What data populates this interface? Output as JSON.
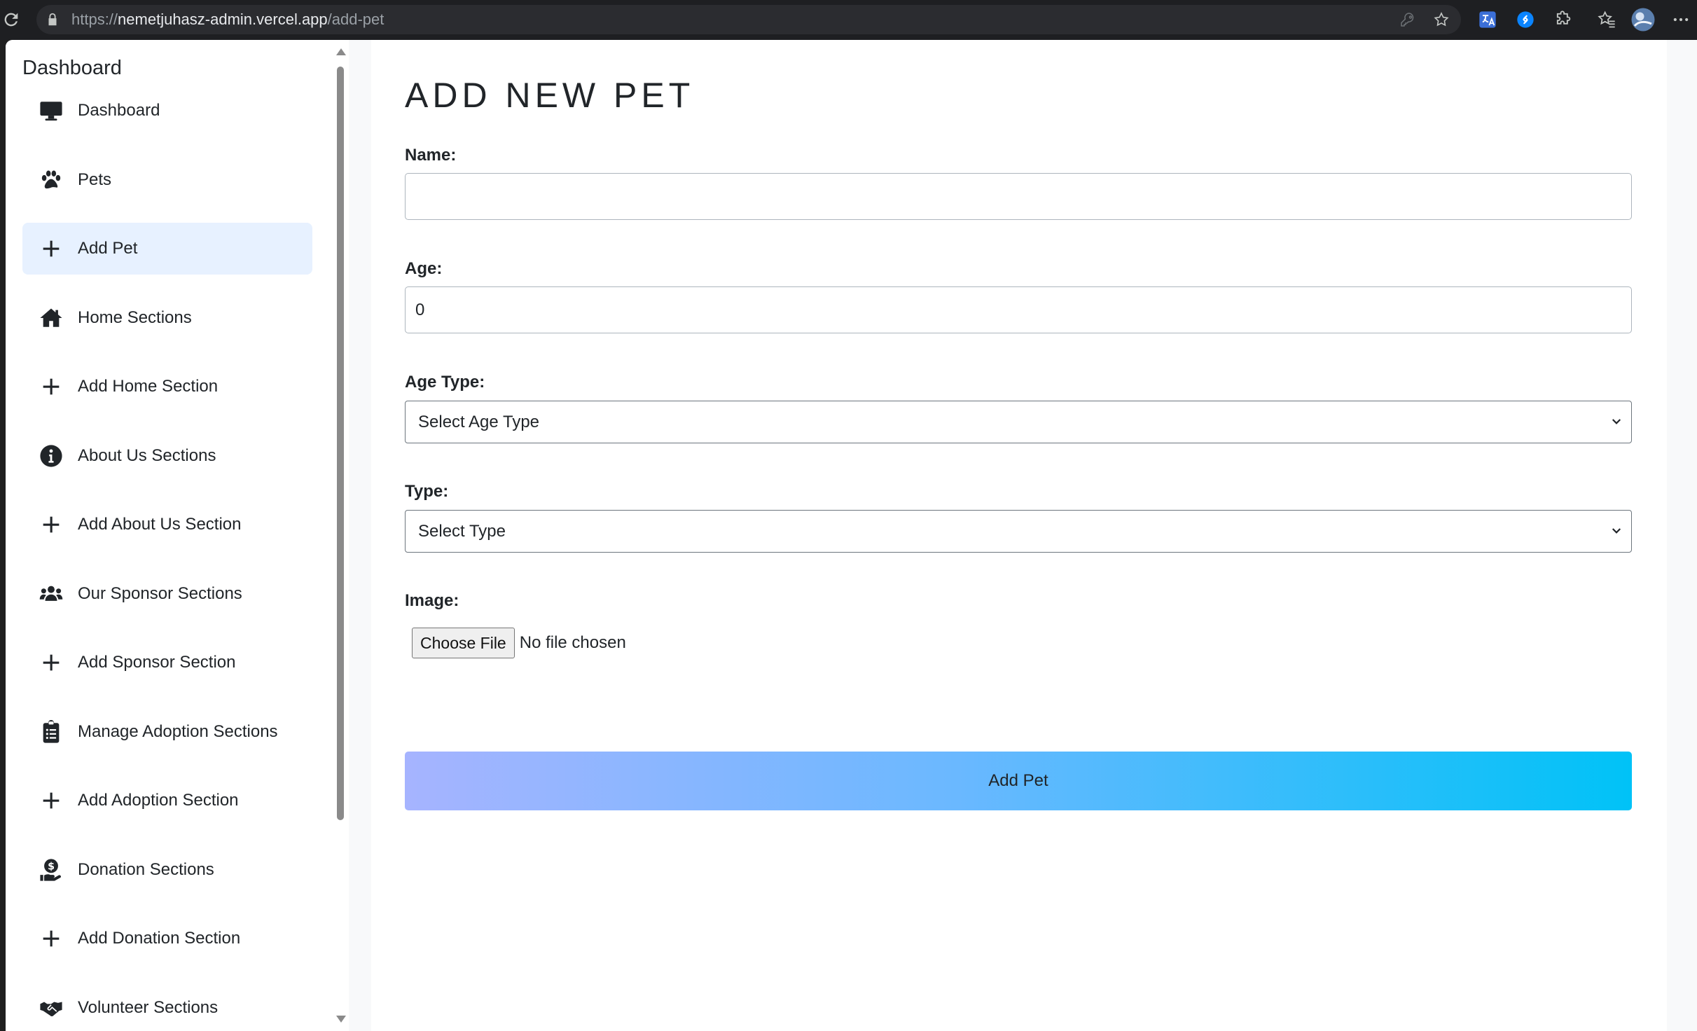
{
  "browser": {
    "url_prefix": "https://",
    "url_host": "nemetjuhasz-admin.vercel.app",
    "url_path": "/add-pet"
  },
  "sidebar": {
    "title": "Dashboard",
    "items": [
      {
        "label": "Dashboard",
        "icon": "desktop-icon"
      },
      {
        "label": "Pets",
        "icon": "paw-icon"
      },
      {
        "label": "Add Pet",
        "icon": "plus-icon",
        "active": true
      },
      {
        "label": "Home Sections",
        "icon": "home-icon"
      },
      {
        "label": "Add Home Section",
        "icon": "plus-icon"
      },
      {
        "label": "About Us Sections",
        "icon": "info-circle-icon"
      },
      {
        "label": "Add About Us Section",
        "icon": "plus-icon"
      },
      {
        "label": "Our Sponsor Sections",
        "icon": "users-icon"
      },
      {
        "label": "Add Sponsor Section",
        "icon": "plus-icon"
      },
      {
        "label": "Manage Adoption Sections",
        "icon": "clipboard-list-icon"
      },
      {
        "label": "Add Adoption Section",
        "icon": "plus-icon"
      },
      {
        "label": "Donation Sections",
        "icon": "hand-holding-dollar-icon"
      },
      {
        "label": "Add Donation Section",
        "icon": "plus-icon"
      },
      {
        "label": "Volunteer Sections",
        "icon": "handshake-icon"
      }
    ]
  },
  "form": {
    "title": "ADD NEW PET",
    "name_label": "Name:",
    "name_value": "",
    "age_label": "Age:",
    "age_value": "0",
    "age_type_label": "Age Type:",
    "age_type_selected": "Select Age Type",
    "type_label": "Type:",
    "type_selected": "Select Type",
    "image_label": "Image:",
    "file_button": "Choose File",
    "file_status": "No file chosen",
    "submit_label": "Add Pet"
  },
  "colors": {
    "active_nav_bg": "#e7f1ff",
    "submit_gradient_start": "#a6b4ff",
    "submit_gradient_end": "#00c2f7"
  }
}
